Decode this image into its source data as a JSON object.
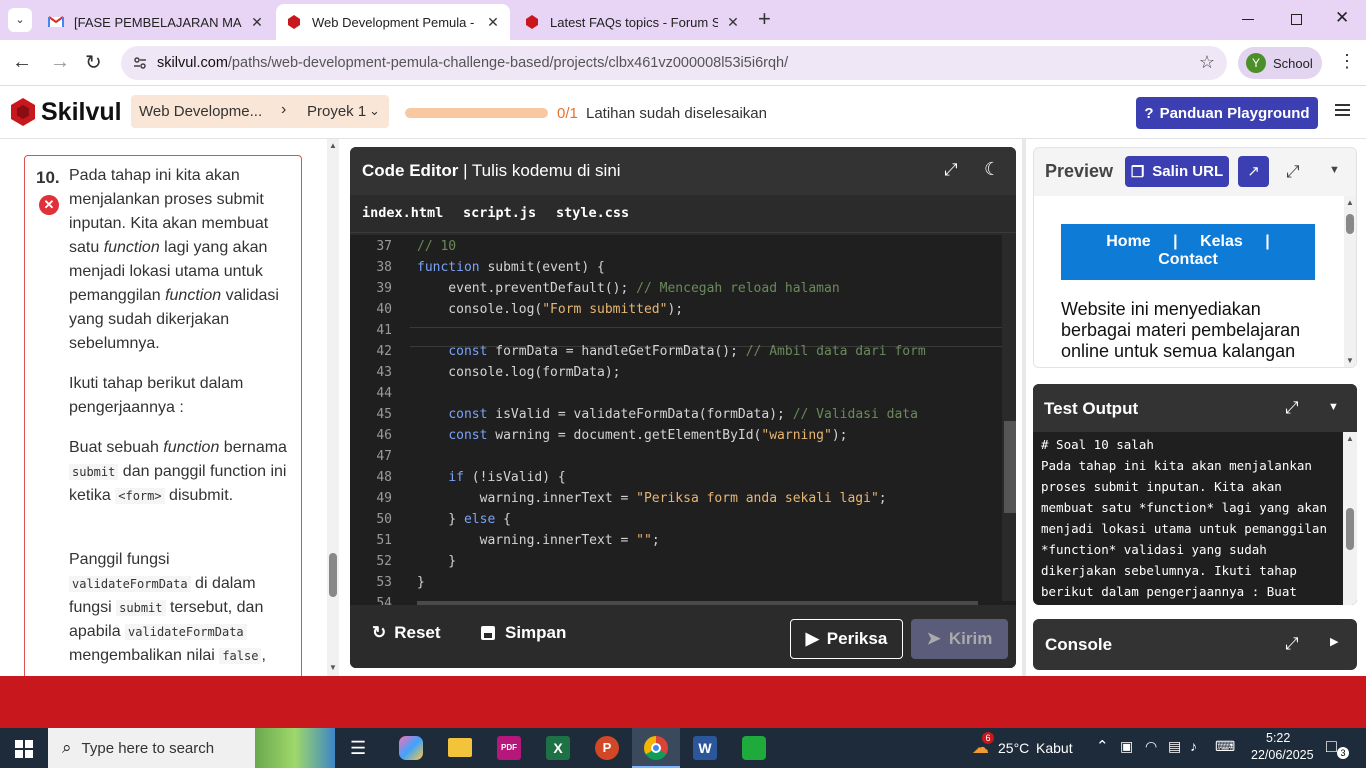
{
  "browser": {
    "tabs": [
      {
        "title": "[FASE PEMBELAJARAN MANDIRI",
        "color": "#d93025"
      },
      {
        "title": "Web Development Pemula - Sp",
        "color": "#c8181e"
      },
      {
        "title": "Latest FAQs topics - Forum Skil",
        "color": "#c8181e"
      }
    ],
    "url_domain": "skilvul.com",
    "url_path": "/paths/web-development-pemula-challenge-based/projects/clbx461vz000008l53i5i6rqh/",
    "profile_initial": "Y",
    "profile_label": "School"
  },
  "header": {
    "logo": "Skilvul",
    "crumb1": "Web Developme...",
    "crumb2": "Proyek 1",
    "progress_count": "0/1",
    "progress_text": "Latihan sudah diselesaikan",
    "progress_fraction": 0,
    "guide_button": "Panduan Playground"
  },
  "task": {
    "number": "10.",
    "p1_a": "Pada tahap ini kita akan menjalankan proses submit inputan. Kita akan membuat satu ",
    "p1_fn": "function",
    "p1_b": " lagi yang akan menjadi lokasi utama untuk pemanggilan ",
    "p1_fn2": "function",
    "p1_c": " validasi yang sudah dikerjakan sebelumnya.",
    "p2": "Ikuti tahap berikut dalam pengerjaannya :",
    "p3_a": "Buat sebuah ",
    "p3_fn": "function",
    "p3_b": " bernama ",
    "p3_code1": "submit",
    "p3_c": " dan panggil function ini ketika ",
    "p3_code2": "<form>",
    "p3_d": " disubmit.",
    "p4_a": "Panggil fungsi ",
    "p4_code1": "validateFormData",
    "p4_b": " di dalam fungsi ",
    "p4_code2": "submit",
    "p4_c": " tersebut, dan apabila ",
    "p4_code3": "validateFormData",
    "p4_d": " mengembalikan nilai ",
    "p4_code4": "false",
    "p4_e": ","
  },
  "editor": {
    "title_bold": "Code Editor",
    "title_rest": " | Tulis kodemu di sini",
    "tabs": [
      "index.html",
      "script.js",
      "style.css"
    ],
    "lines": [
      {
        "n": "37",
        "code": [
          {
            "t": "// 10",
            "c": "cm"
          }
        ]
      },
      {
        "n": "38",
        "code": [
          {
            "t": "function",
            "c": "kw"
          },
          {
            "t": " submit(event) {",
            "c": ""
          }
        ]
      },
      {
        "n": "39",
        "code": [
          {
            "t": "    event.preventDefault(); ",
            "c": ""
          },
          {
            "t": "// Mencegah reload halaman",
            "c": "cm"
          }
        ]
      },
      {
        "n": "40",
        "code": [
          {
            "t": "    console.log(",
            "c": ""
          },
          {
            "t": "\"Form submitted\"",
            "c": "st"
          },
          {
            "t": ");",
            "c": ""
          }
        ]
      },
      {
        "n": "41",
        "code": [
          {
            "t": "",
            "c": ""
          }
        ]
      },
      {
        "n": "42",
        "code": [
          {
            "t": "    ",
            "c": ""
          },
          {
            "t": "const",
            "c": "kw"
          },
          {
            "t": " formData = handleGetFormData(); ",
            "c": ""
          },
          {
            "t": "// Ambil data dari form",
            "c": "cm"
          }
        ]
      },
      {
        "n": "43",
        "code": [
          {
            "t": "    console.log(formData);",
            "c": ""
          }
        ]
      },
      {
        "n": "44",
        "code": [
          {
            "t": "",
            "c": ""
          }
        ]
      },
      {
        "n": "45",
        "code": [
          {
            "t": "    ",
            "c": ""
          },
          {
            "t": "const",
            "c": "kw"
          },
          {
            "t": " isValid = validateFormData(formData); ",
            "c": ""
          },
          {
            "t": "// Validasi data",
            "c": "cm"
          }
        ]
      },
      {
        "n": "46",
        "code": [
          {
            "t": "    ",
            "c": ""
          },
          {
            "t": "const",
            "c": "kw"
          },
          {
            "t": " warning = document.getElementById(",
            "c": ""
          },
          {
            "t": "\"warning\"",
            "c": "st"
          },
          {
            "t": ");",
            "c": ""
          }
        ]
      },
      {
        "n": "47",
        "code": [
          {
            "t": "",
            "c": ""
          }
        ]
      },
      {
        "n": "48",
        "code": [
          {
            "t": "    ",
            "c": ""
          },
          {
            "t": "if",
            "c": "kw"
          },
          {
            "t": " (!isValid) {",
            "c": ""
          }
        ]
      },
      {
        "n": "49",
        "code": [
          {
            "t": "        warning.innerText = ",
            "c": ""
          },
          {
            "t": "\"Periksa form anda sekali lagi\"",
            "c": "st"
          },
          {
            "t": ";",
            "c": ""
          }
        ]
      },
      {
        "n": "50",
        "code": [
          {
            "t": "    } ",
            "c": ""
          },
          {
            "t": "else",
            "c": "kw"
          },
          {
            "t": " {",
            "c": ""
          }
        ]
      },
      {
        "n": "51",
        "code": [
          {
            "t": "        warning.innerText = ",
            "c": ""
          },
          {
            "t": "\"\"",
            "c": "st"
          },
          {
            "t": ";",
            "c": ""
          }
        ]
      },
      {
        "n": "52",
        "code": [
          {
            "t": "    }",
            "c": ""
          }
        ]
      },
      {
        "n": "53",
        "code": [
          {
            "t": "}",
            "c": ""
          }
        ]
      },
      {
        "n": "54",
        "code": [
          {
            "t": "",
            "c": ""
          }
        ]
      }
    ],
    "reset_label": "Reset",
    "save_label": "Simpan",
    "check_label": "Periksa",
    "send_label": "Kirim"
  },
  "preview": {
    "title": "Preview",
    "copy_url": "Salin URL",
    "nav_home": "Home",
    "nav_kelas": "Kelas",
    "nav_contact": "Contact",
    "nav_sep": "|",
    "body_text": "Website ini menyediakan berbagai materi pembelajaran online untuk semua kalangan"
  },
  "test_output": {
    "title": "Test Output",
    "lines": [
      "# Soal 10 salah",
      "Pada tahap ini kita akan menjalankan",
      "proses submit inputan. Kita akan",
      "membuat satu *function* lagi yang akan",
      "menjadi lokasi utama untuk pemanggilan",
      "*function* validasi yang sudah",
      "dikerjakan sebelumnya. Ikuti tahap",
      "berikut dalam pengerjaannya : Buat"
    ]
  },
  "console": {
    "title": "Console"
  },
  "taskbar": {
    "search_placeholder": "Type here to search",
    "weather_temp": "25°C",
    "weather_desc": "Kabut",
    "weather_badge": "6",
    "time": "5:22",
    "date": "22/06/2025",
    "notif_count": "3"
  },
  "colors": {
    "brand_red": "#c8181e",
    "accent_blue": "#3b3fb1",
    "preview_nav": "#0e7bd6",
    "progress_track": "#f8c9a0"
  }
}
